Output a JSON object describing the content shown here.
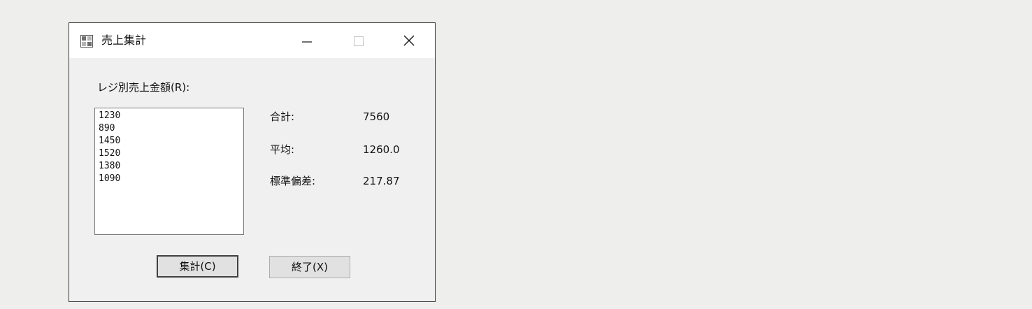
{
  "window": {
    "title": "売上集計",
    "icon": "app-form-icon",
    "controls": {
      "minimize_icon": "minimize-icon",
      "maximize_icon": "maximize-icon",
      "close_icon": "close-icon"
    }
  },
  "main": {
    "list_label": "レジ別売上金額(R):",
    "list_items": [
      "1230",
      "890",
      "1450",
      "1520",
      "1380",
      "1090"
    ],
    "stats": [
      {
        "label": "合計:",
        "value": "7560"
      },
      {
        "label": "平均:",
        "value": "1260.0"
      },
      {
        "label": "標準偏差:",
        "value": "217.87"
      }
    ],
    "buttons": {
      "calc_label": "集計(C)",
      "exit_label": "終了(X)"
    }
  },
  "colors": {
    "desktop": "#eeeeed",
    "window_bg": "#f0f0f0",
    "titlebar_bg": "#ffffff",
    "button_bg": "#e1e1e1",
    "default_button_border": "#404040"
  }
}
